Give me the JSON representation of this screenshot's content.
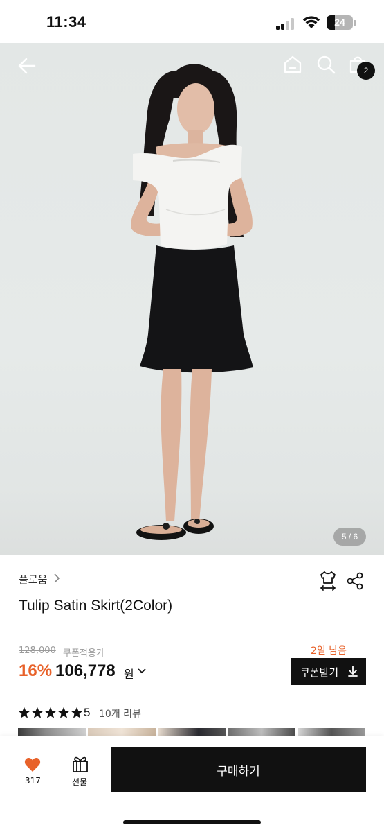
{
  "status_bar": {
    "time": "11:34",
    "battery": "24"
  },
  "header": {
    "cart_count": "2"
  },
  "gallery": {
    "indicator": "5 / 6"
  },
  "product": {
    "brand": "플로움",
    "title": "Tulip Satin Skirt(2Color)",
    "original_price": "128,000",
    "coupon_note": "쿠폰적용가",
    "time_left": "2일 남음",
    "discount": "16%",
    "sale_price": "106,778",
    "currency": "원",
    "coupon_button": "쿠폰받기",
    "rating": "5",
    "review_link": "10개 리뷰"
  },
  "bottom_bar": {
    "like_count": "317",
    "gift_label": "선물",
    "buy_label": "구매하기"
  },
  "colors": {
    "accent": "#e8622a",
    "dark": "#111111",
    "muted": "#9a9a9a"
  },
  "icons": [
    "back-arrow-icon",
    "home-icon",
    "search-icon",
    "cart-icon",
    "size-guide-icon",
    "share-icon",
    "chevron-right-icon",
    "chevron-down-icon",
    "download-icon",
    "star-icon",
    "heart-icon",
    "gift-icon"
  ]
}
